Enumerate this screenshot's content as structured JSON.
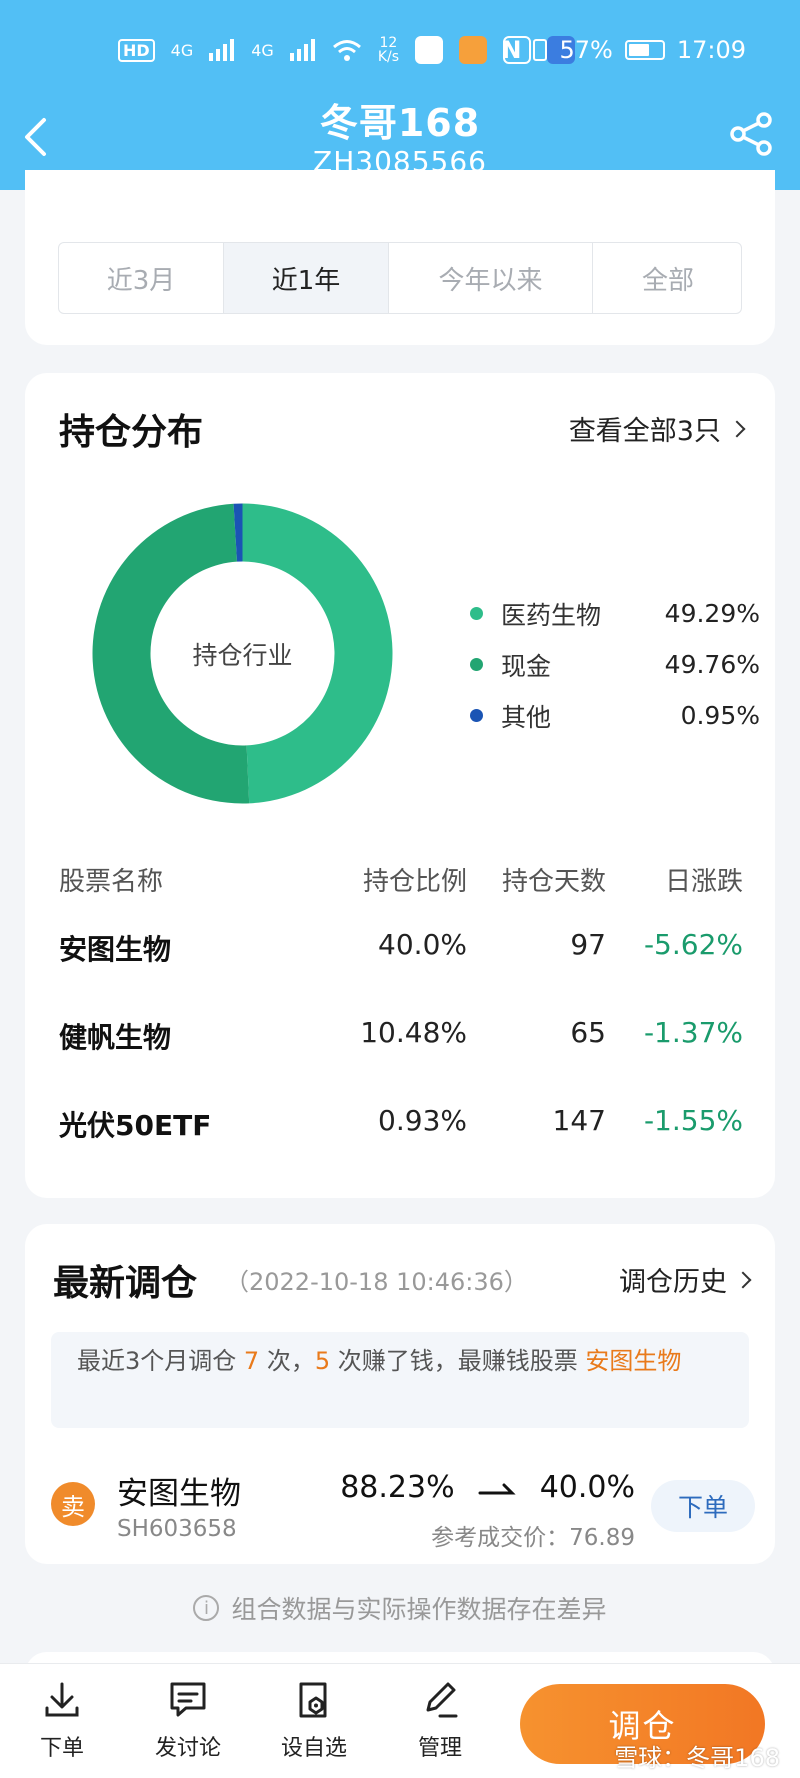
{
  "status_bar": {
    "network_1": "4G",
    "network_2": "4G",
    "speed_value": "12",
    "speed_unit": "K/s",
    "battery_percent": "57%",
    "time": "17:09"
  },
  "header": {
    "title": "冬哥168",
    "subtitle": "ZH3085566"
  },
  "period_tabs": {
    "items": [
      "近3月",
      "近1年",
      "今年以来",
      "全部"
    ],
    "active_index": 1
  },
  "holdings": {
    "title": "持仓分布",
    "view_all": "查看全部3只",
    "donut_center_label": "持仓行业",
    "table_headers": [
      "股票名称",
      "持仓比例",
      "持仓天数",
      "日涨跌"
    ],
    "rows": [
      {
        "name": "安图生物",
        "ratio": "40.0%",
        "days": "97",
        "change": "-5.62%"
      },
      {
        "name": "健帆生物",
        "ratio": "10.48%",
        "days": "65",
        "change": "-1.37%"
      },
      {
        "name": "光伏50ETF",
        "ratio": "0.93%",
        "days": "147",
        "change": "-1.55%"
      }
    ]
  },
  "chart_data": {
    "type": "pie",
    "title": "持仓行业",
    "categories": [
      "医药生物",
      "现金",
      "其他"
    ],
    "values": [
      49.29,
      49.76,
      0.95
    ],
    "value_labels": [
      "49.29%",
      "49.76%",
      "0.95%"
    ],
    "colors": [
      "#2ebd8a",
      "#22a572",
      "#1a54b4"
    ],
    "legend_position": "right"
  },
  "rebalance": {
    "title": "最新调仓",
    "timestamp": "（2022-10-18 10:46:36）",
    "history_link": "调仓历史",
    "notice": {
      "part1": "最近3个月调仓 ",
      "count_trades": "7",
      "part2": " 次，",
      "count_profit": "5",
      "part3": " 次赚了钱，最赚钱股票 ",
      "best_stock": "安图生物"
    },
    "trade": {
      "action": "卖",
      "name": "安图生物",
      "code": "SH603658",
      "from": "88.23%",
      "to": "40.0%",
      "price_label": "参考成交价：",
      "price": "76.89",
      "order_button": "下单"
    }
  },
  "disclaimer": "组合数据与实际操作数据存在差异",
  "bottom_tabs": [
    {
      "label": "下单",
      "icon": "download-icon"
    },
    {
      "label": "发讨论",
      "icon": "chat-icon"
    },
    {
      "label": "设自选",
      "icon": "favorite-icon"
    },
    {
      "label": "管理",
      "icon": "edit-icon"
    }
  ],
  "cta_label": "调仓",
  "watermark": "雪球：冬哥168",
  "colors": {
    "header_bg": "#52bff5",
    "accent_orange": "#f27724",
    "down_green": "#1a9b6c"
  }
}
